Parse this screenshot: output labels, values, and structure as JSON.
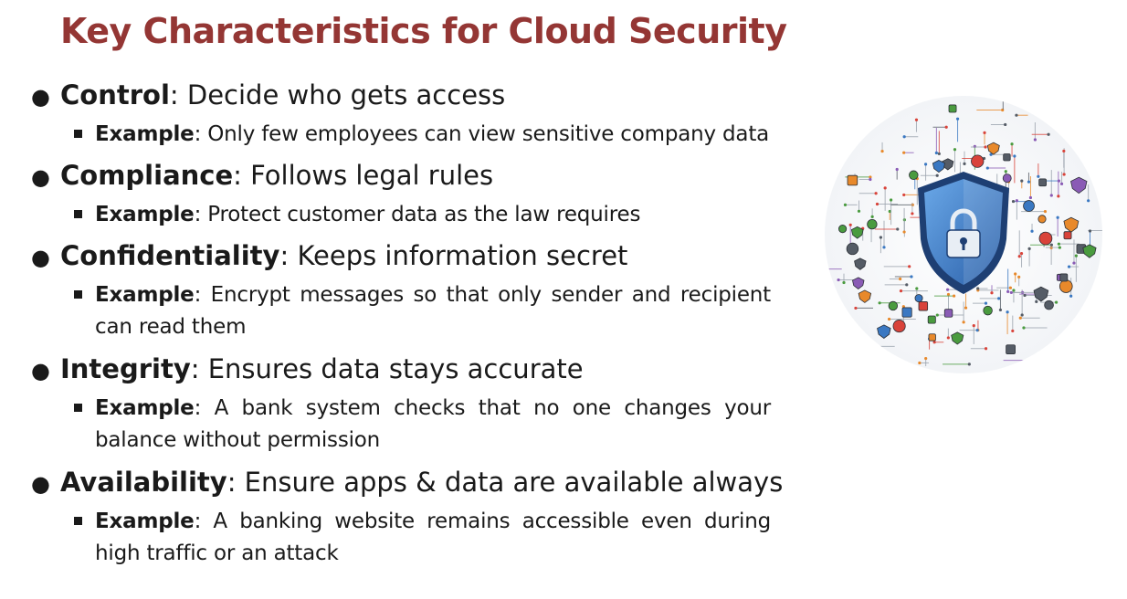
{
  "slide": {
    "title": "Key Characteristics for Cloud Security",
    "items": [
      {
        "term": "Control",
        "description": ": Decide who gets access",
        "example_label": "Example",
        "example_text": ": Only few employees can view sensitive company data"
      },
      {
        "term": "Compliance",
        "description": ": Follows legal rules",
        "example_label": "Example",
        "example_text": ": Protect customer data as the law requires"
      },
      {
        "term": "Confidentiality",
        "description": ": Keeps information secret",
        "example_label": "Example",
        "example_text": ": Encrypt messages so that only sender and recipient can read them"
      },
      {
        "term": "Integrity",
        "description": ": Ensures data stays accurate",
        "example_label": "Example",
        "example_text": ": A bank system checks that no one changes your balance without permission"
      },
      {
        "term": "Availability",
        "description": ": Ensure apps & data are available always",
        "example_label": "Example",
        "example_text": ": A banking website remains accessible even during high traffic or an attack"
      }
    ]
  },
  "illustration": {
    "icon": "security-shield-network-icon",
    "colors": {
      "shield": "#3a78c2",
      "shield_edge": "#1e3f73",
      "lock": "#e8eef5",
      "accent_red": "#d9433a",
      "accent_green": "#4a9b3f",
      "accent_orange": "#e8892b"
    }
  }
}
